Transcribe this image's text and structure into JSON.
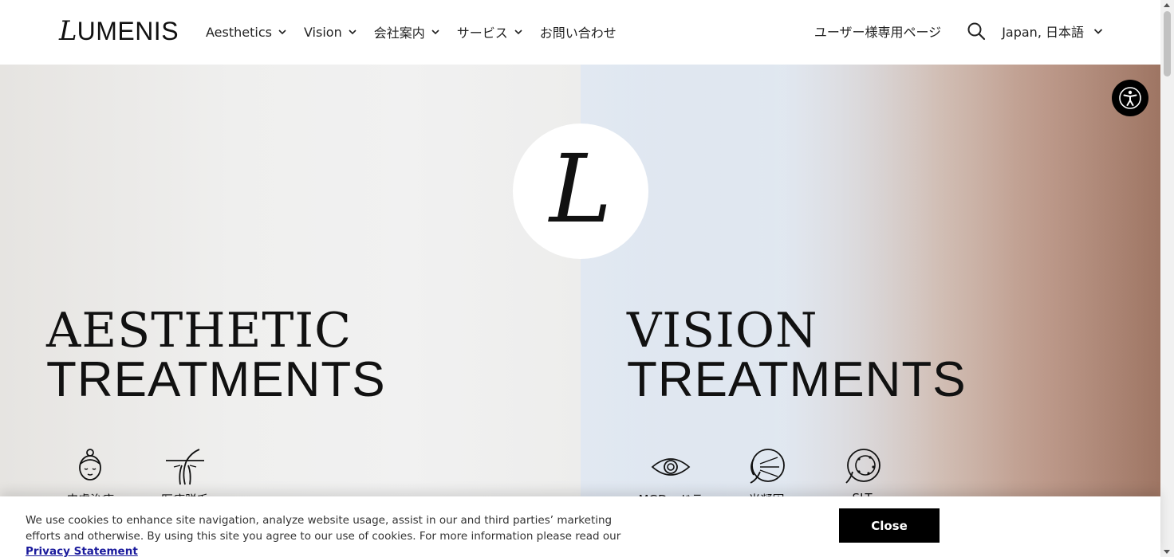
{
  "header": {
    "logo_initial": "L",
    "logo_rest": "UMENIS",
    "nav": [
      {
        "label": "Aesthetics"
      },
      {
        "label": "Vision"
      },
      {
        "label": "会社案内"
      },
      {
        "label": "サービス"
      },
      {
        "label": "お問い合わせ"
      }
    ],
    "user_page": "ユーザー様専用ページ",
    "language": "Japan, 日本語"
  },
  "hero": {
    "logo_mark": "L",
    "left": {
      "title_line1": "AESTHETIC",
      "title_line2": "TREATMENTS",
      "tiles": [
        {
          "label": "皮膚治療",
          "icon": "face-icon"
        },
        {
          "label": "医療脱毛",
          "icon": "hair-follicle-icon"
        }
      ]
    },
    "right": {
      "title_line1": "VISION",
      "title_line2": "TREATMENTS",
      "tiles": [
        {
          "label": "MGD・ドラ",
          "icon": "eye-icon"
        },
        {
          "label": "光凝固",
          "icon": "eye-cross-section-icon"
        },
        {
          "label": "SLT",
          "icon": "eye-laser-icon"
        }
      ]
    }
  },
  "cookie": {
    "text": "We use cookies to enhance site navigation, analyze website usage, assist in our and third parties’ marketing efforts and otherwise. By using this site you agree to our use of cookies. For more information please read our ",
    "link": "Privacy Statement",
    "close": "Close"
  },
  "colors": {
    "text": "#111111",
    "button_bg": "#000000",
    "link": "#1a1a9c"
  }
}
